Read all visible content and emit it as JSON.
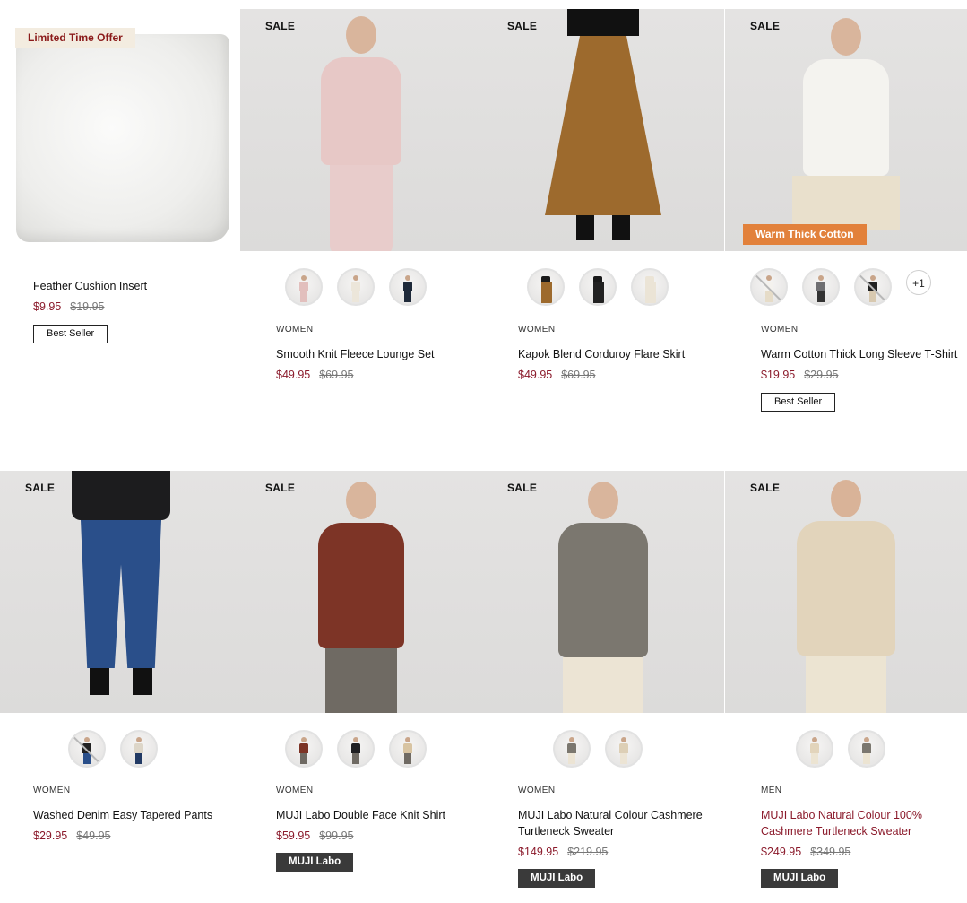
{
  "products": [
    {
      "category": "",
      "name": "Feather Cushion Insert",
      "price": "$9.95",
      "was": "$19.95",
      "badge": "Best Seller",
      "ribbon": "Limited Time Offer",
      "sale": ""
    },
    {
      "category": "WOMEN",
      "name": "Smooth Knit Fleece Lounge Set",
      "price": "$49.95",
      "was": "$69.95",
      "badge": "",
      "sale": "SALE"
    },
    {
      "category": "WOMEN",
      "name": "Kapok Blend Corduroy Flare Skirt",
      "price": "$49.95",
      "was": "$69.95",
      "badge": "",
      "sale": "SALE"
    },
    {
      "category": "WOMEN",
      "name": "Warm Cotton Thick Long Sleeve T-Shirt",
      "price": "$19.95",
      "was": "$29.95",
      "badge": "Best Seller",
      "sale": "SALE",
      "ribbon": "Warm Thick Cotton",
      "more_colors": "+1"
    },
    {
      "category": "WOMEN",
      "name": "Washed Denim Easy Tapered Pants",
      "price": "$29.95",
      "was": "$49.95",
      "badge": "",
      "sale": "SALE"
    },
    {
      "category": "WOMEN",
      "name": "MUJI Labo Double Face Knit Shirt",
      "price": "$59.95",
      "was": "$99.95",
      "badge": "MUJI Labo",
      "sale": "SALE"
    },
    {
      "category": "WOMEN",
      "name": "MUJI Labo Natural Colour Cashmere Turtleneck Sweater",
      "price": "$149.95",
      "was": "$219.95",
      "badge": "MUJI Labo",
      "sale": "SALE"
    },
    {
      "category": "MEN",
      "name": "MUJI Labo Natural Colour 100% Cashmere Turtleneck Sweater",
      "price": "$249.95",
      "was": "$349.95",
      "badge": "MUJI Labo",
      "sale": "SALE"
    }
  ],
  "colors": {
    "sale_price": "#8b1a2b",
    "ribbon_limited_bg": "#f3ece0",
    "ribbon_warm_bg": "#e2813b",
    "labo_badge_bg": "#3a3a3a"
  }
}
